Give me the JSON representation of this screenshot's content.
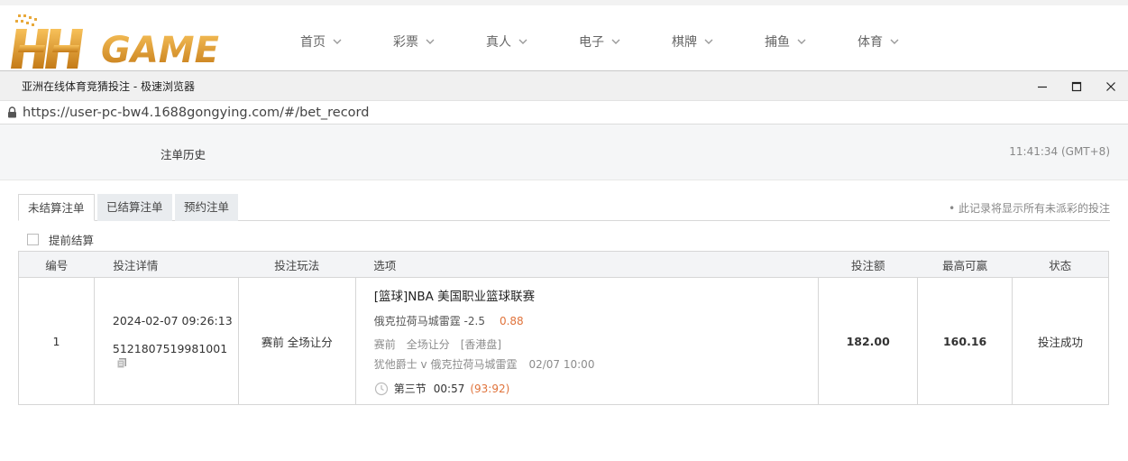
{
  "site": {
    "logo_text": "HH GAME",
    "nav": [
      {
        "label": "首页"
      },
      {
        "label": "彩票"
      },
      {
        "label": "真人"
      },
      {
        "label": "电子"
      },
      {
        "label": "棋牌"
      },
      {
        "label": "捕鱼"
      },
      {
        "label": "体育"
      }
    ]
  },
  "window": {
    "title": "亚洲在线体育竞猜投注 - 极速浏览器",
    "url": "https://user-pc-bw4.1688gongying.com/#/bet_record"
  },
  "page": {
    "title": "注单历史",
    "clock": "11:41:34 (GMT+8)",
    "tabs": [
      {
        "label": "未结算注单",
        "active": true
      },
      {
        "label": "已结算注单",
        "active": false
      },
      {
        "label": "预约注单",
        "active": false
      }
    ],
    "tab_note": "• 此记录将显示所有未派彩的投注",
    "early_settle_label": "提前结算"
  },
  "table": {
    "headers": [
      "编号",
      "投注详情",
      "投注玩法",
      "选项",
      "投注额",
      "最高可赢",
      "状态"
    ],
    "rows": [
      {
        "no": "1",
        "time": "2024-02-07 09:26:13",
        "order_id": "5121807519981001",
        "play": "赛前 全场让分",
        "league": "[篮球]NBA 美国职业篮球联赛",
        "pick": "俄克拉荷马城雷霆 -2.5",
        "odds": "0.88",
        "market": "赛前　全场让分　[香港盘]",
        "match": "犹他爵士 v 俄克拉荷马城雷霆",
        "match_time": "02/07 10:00",
        "period": "第三节",
        "clock": "00:57",
        "score": "(93:92)",
        "stake": "182.00",
        "max_win": "160.16",
        "status": "投注成功"
      }
    ]
  },
  "colors": {
    "accent_orange": "#e0733b",
    "logo_gold": "#e8a93b"
  }
}
